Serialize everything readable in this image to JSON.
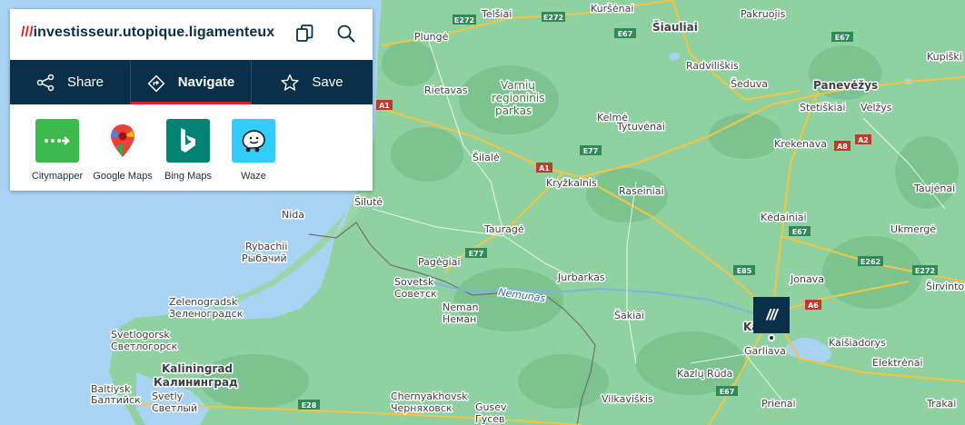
{
  "address": {
    "prefix": "///",
    "words": "investisseur.utopique.ligamenteux"
  },
  "icons": {
    "copy": "copy-icon",
    "search": "search-icon"
  },
  "tabs": [
    {
      "label": "Share",
      "icon": "share-icon"
    },
    {
      "label": "Navigate",
      "icon": "navigate-icon",
      "active": true
    },
    {
      "label": "Save",
      "icon": "star-icon"
    }
  ],
  "apps": [
    {
      "label": "Citymapper",
      "color": "#3dba4e"
    },
    {
      "label": "Google Maps",
      "color": "#ffffff"
    },
    {
      "label": "Bing Maps",
      "color": "#008373"
    },
    {
      "label": "Waze",
      "color": "#33ccff"
    }
  ],
  "marker": {
    "text": "///"
  },
  "colors": {
    "brand_navy": "#0a3049",
    "brand_red": "#e11f26",
    "land": "#86cd9a",
    "sea": "#a9d3f2"
  },
  "map": {
    "places": {
      "telsiai": "Telšiai",
      "kursenai": "Kuršėnai",
      "siauliai": "Šiauliai",
      "pakruojis": "Pakruojis",
      "plunge": "Plungė",
      "radviliskis": "Radviliškis",
      "panevezys": "Panevėžys",
      "kupiskis": "Kupiški",
      "rietavas": "Rietavas",
      "seduva": "Šeduva",
      "stetiskiai": "Stetiškiai",
      "velzys": "Velžys",
      "kelme": "Kelmė",
      "tytuvenai": "Tytuvėnai",
      "silale": "Šilalė",
      "krekenava": "Krekenava",
      "kryzkalnis": "Kryžkalnis",
      "raseiniai": "Raseiniai",
      "silute": "Šilutė",
      "taujenai": "Taujėnai",
      "nida": "Nida",
      "taurage": "Tauragė",
      "kedainiai": "Kėdainiai",
      "ukmerge": "Ukmergė",
      "rybachii": "Rybachii",
      "rybachii_ru": "Рыбачий",
      "pagegiai": "Pagėgiai",
      "jurbarkas": "Jurbarkas",
      "jonava": "Jonava",
      "sovetsk": "Sovetsk",
      "sovetsk_ru": "Советск",
      "sirvintos": "Širvintos",
      "zelenogradsk": "Zelenogradsk",
      "zelenogradsk_ru": "Зеленоградск",
      "neman": "Neman",
      "neman_ru": "Неман",
      "sakiai": "Šakiai",
      "kaunas": "Kaunas",
      "svetlogorsk": "Svetlogorsk",
      "svetlogorsk_ru": "Светлогорск",
      "garliava": "Garliava",
      "kaisiadorys": "Kaišiadorys",
      "kaliningrad": "Kaliningrad",
      "kaliningrad_ru": "Калининград",
      "kazlu_ruda": "Kazlų Rūda",
      "elektrenai": "Elektrėnai",
      "baltiysk": "Baltiysk",
      "baltiysk_ru": "Балтийск",
      "svetly": "Svetly",
      "svetly_ru": "Светлый",
      "chernyakhovsk": "Chernyakhovsk",
      "chernyakhovsk_ru": "Черняховск",
      "vilkaviskis": "Vilkaviškis",
      "prienai": "Prienai",
      "trakai": "Trakai",
      "gusev": "Gusev",
      "gusev_ru": "Гусев"
    },
    "park": {
      "line1": "Varnių",
      "line2": "regioninis",
      "line3": "parkas"
    },
    "river": "Nemunas",
    "roads": {
      "e272a": "E272",
      "e272b": "E272",
      "e67a": "E67",
      "e67b": "E67",
      "e67c": "E67",
      "e67d": "E67",
      "a1a": "A1",
      "a1b": "A1",
      "e77a": "E77",
      "e77b": "E77",
      "a8": "A8",
      "a2": "A2",
      "e85": "E85",
      "a6": "A6",
      "e262": "E262",
      "e28": "E28"
    }
  }
}
